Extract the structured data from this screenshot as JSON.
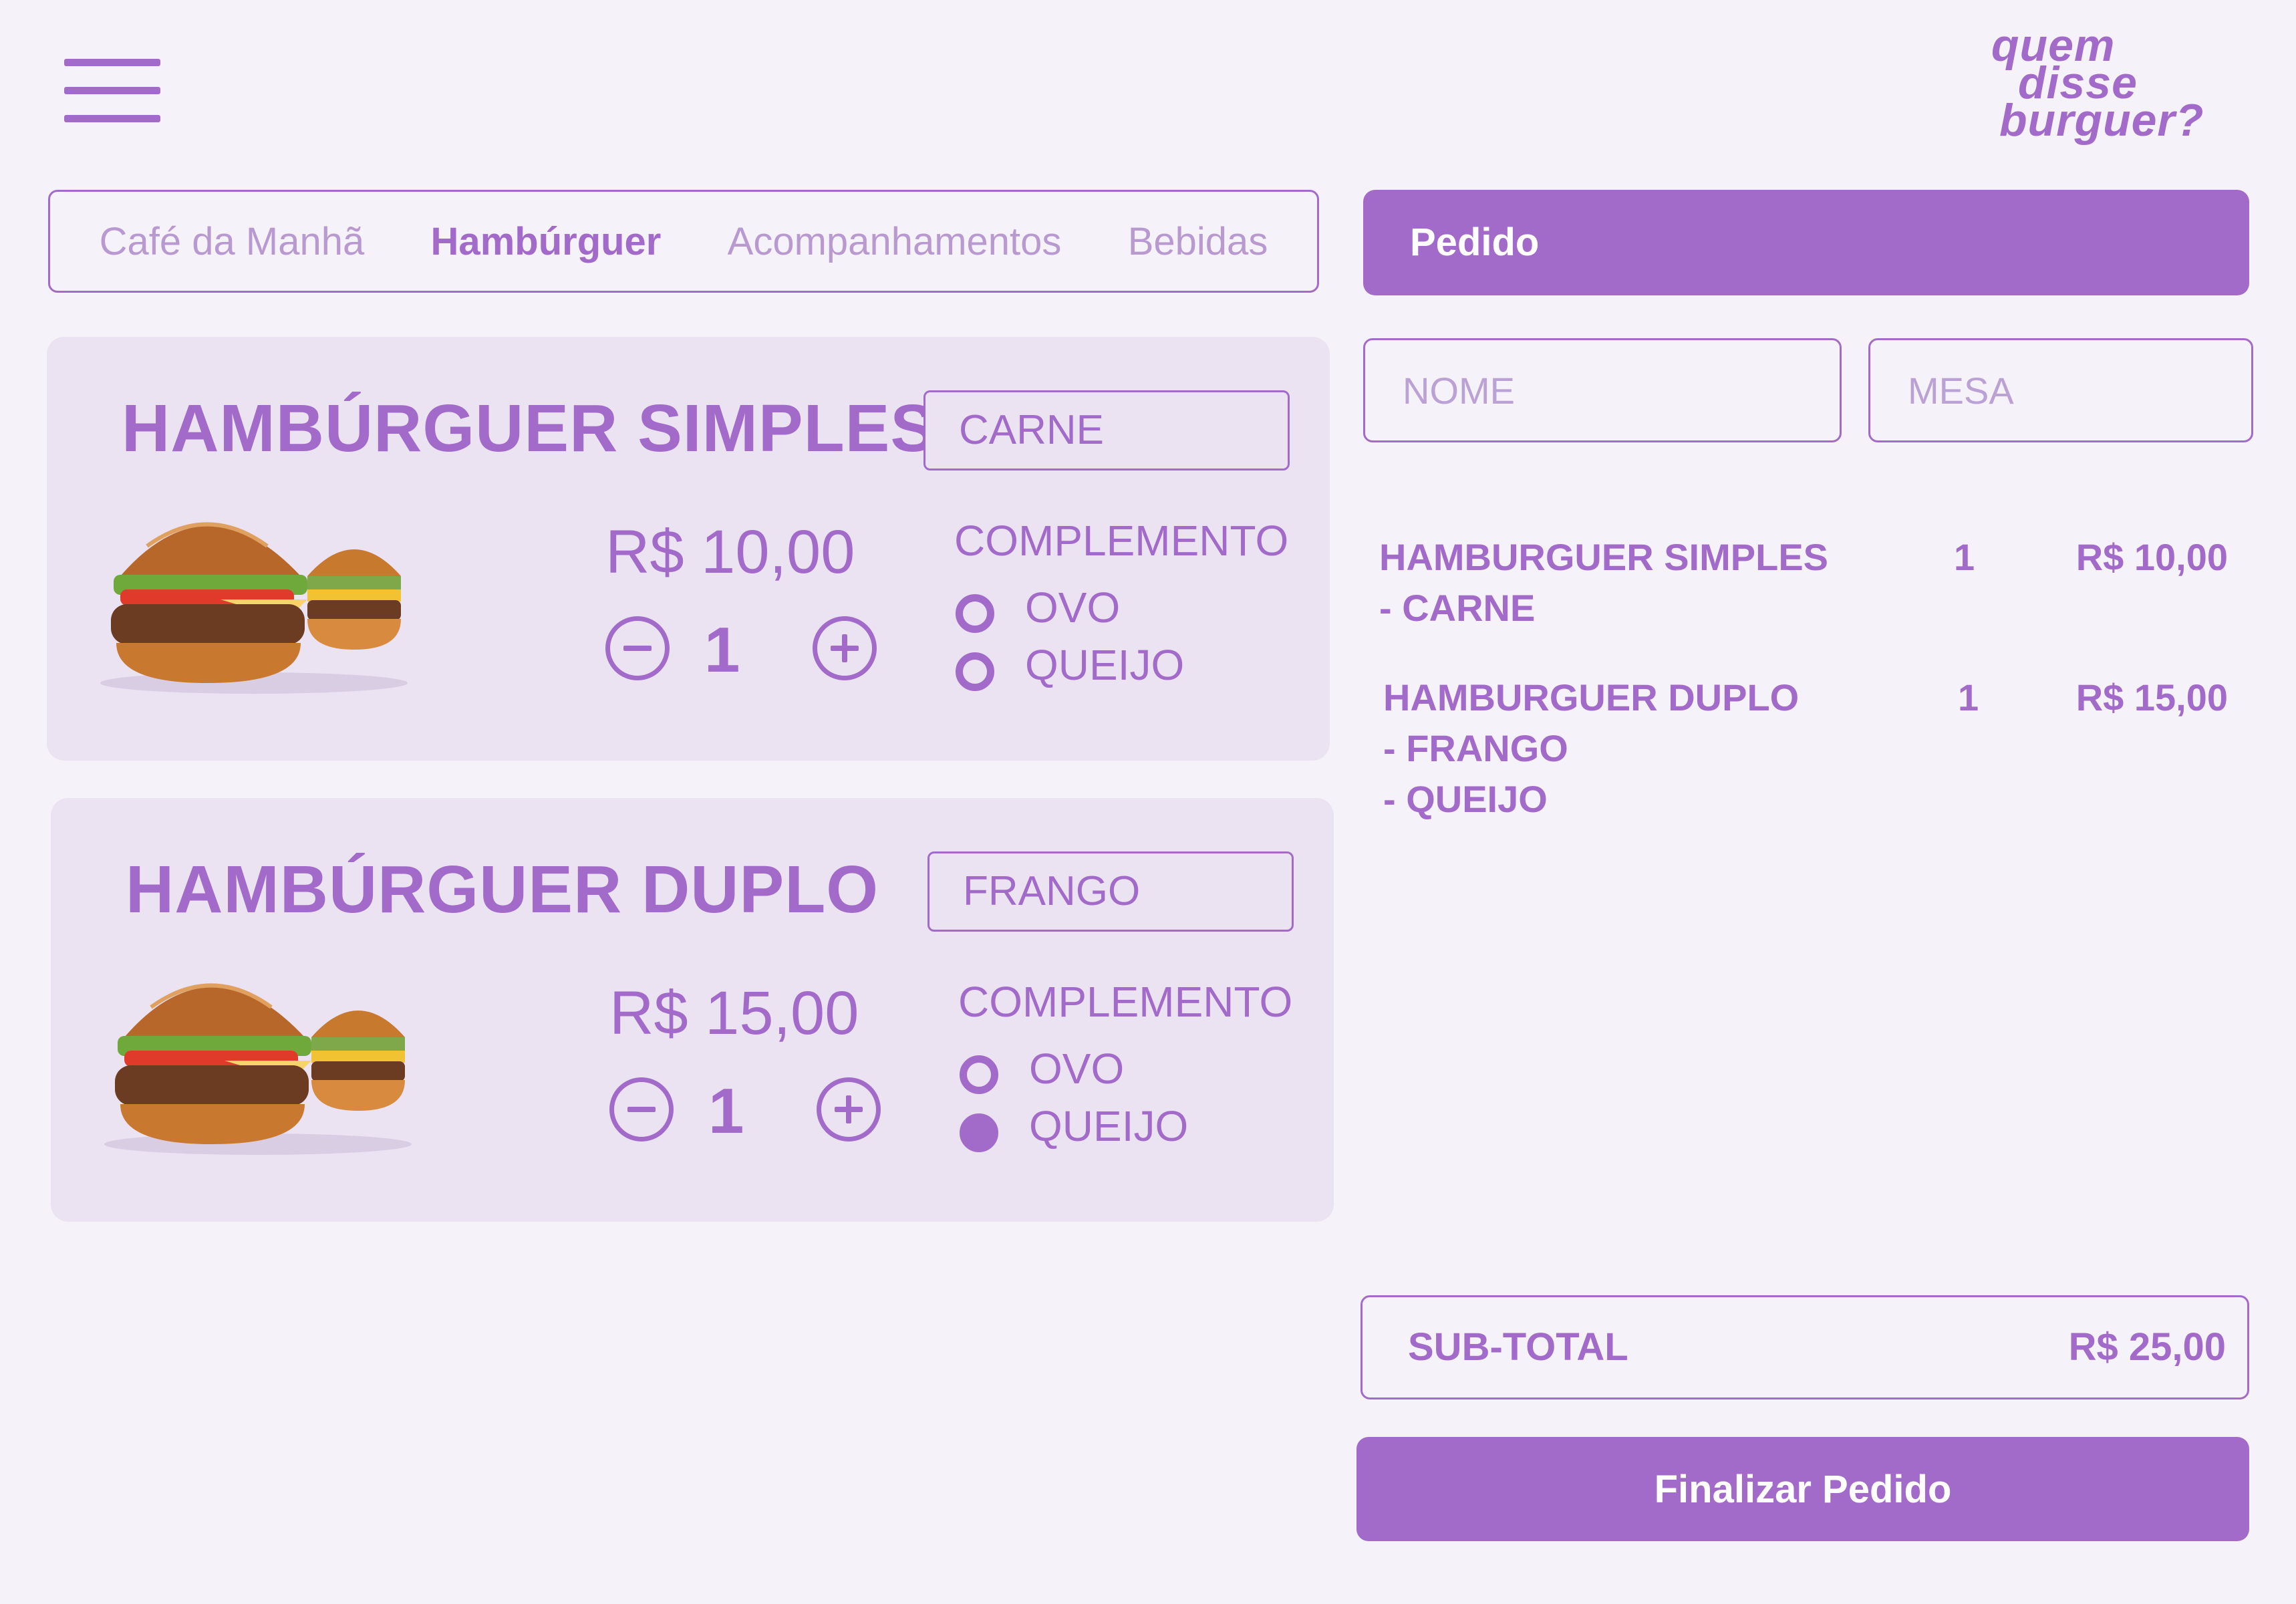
{
  "brand": {
    "logo_lines": [
      "quem",
      "disse",
      "burguer?"
    ]
  },
  "tabs": [
    {
      "label": "Café da Manhã",
      "active": false
    },
    {
      "label": "Hambúrguer",
      "active": true
    },
    {
      "label": "Acompanhamentos",
      "active": false
    },
    {
      "label": "Bebidas",
      "active": false
    }
  ],
  "products": [
    {
      "title": "HAMBÚRGUER SIMPLES",
      "protein": "CARNE",
      "price": "R$ 10,00",
      "quantity": "1",
      "complement_label": "COMPLEMENTO",
      "complements": [
        {
          "label": "OVO",
          "selected": false
        },
        {
          "label": "QUEIJO",
          "selected": false
        }
      ]
    },
    {
      "title": "HAMBÚRGUER DUPLO",
      "protein": "FRANGO",
      "price": "R$ 15,00",
      "quantity": "1",
      "complement_label": "COMPLEMENTO",
      "complements": [
        {
          "label": "OVO",
          "selected": false
        },
        {
          "label": "QUEIJO",
          "selected": true
        }
      ]
    }
  ],
  "order": {
    "header": "Pedido",
    "name_placeholder": "NOME",
    "table_placeholder": "MESA",
    "items": [
      {
        "lines": [
          "HAMBURGUER SIMPLES",
          "- CARNE"
        ],
        "qty": "1",
        "price": "R$ 10,00"
      },
      {
        "lines": [
          "HAMBURGUER DUPLO",
          "- FRANGO",
          "- QUEIJO"
        ],
        "qty": "1",
        "price": "R$ 15,00"
      }
    ],
    "subtotal_label": "SUB-TOTAL",
    "subtotal_value": "R$ 25,00",
    "finish_label": "Finalizar Pedido"
  },
  "colors": {
    "accent": "#a36bc9",
    "card": "#ebe2f2",
    "background": "#f6f2f9",
    "tab_inactive": "#b89ad0"
  }
}
